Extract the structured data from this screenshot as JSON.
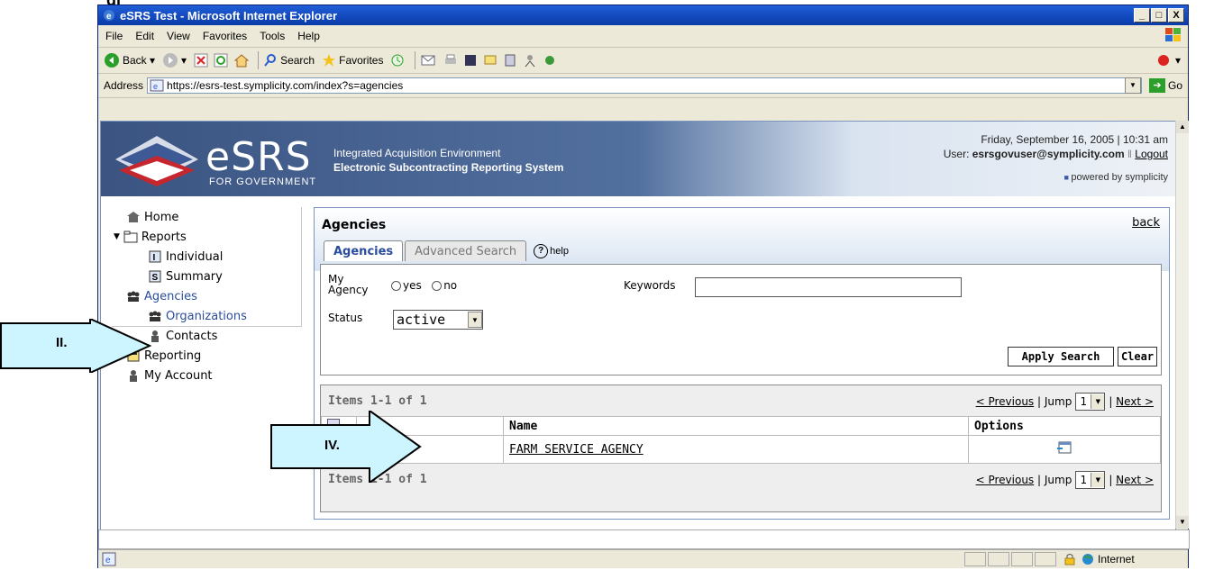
{
  "heading_fragment": "gl",
  "window": {
    "title": "eSRS Test - Microsoft Internet Explorer",
    "controls": [
      "_",
      "□",
      "X"
    ]
  },
  "menu": [
    "File",
    "Edit",
    "View",
    "Favorites",
    "Tools",
    "Help"
  ],
  "toolbar": {
    "back": "Back",
    "search": "Search",
    "favorites": "Favorites"
  },
  "address": {
    "label": "Address",
    "url": "https://esrs-test.symplicity.com/index?s=agencies",
    "go": "Go"
  },
  "banner": {
    "logo_text": "eSRS",
    "for_government": "FOR GOVERNMENT",
    "subtitle1": "Integrated Acquisition Environment",
    "subtitle2": "Electronic Subcontracting Reporting System",
    "date": "Friday, September 16, 2005 | 10:31 am",
    "user_label": "User:",
    "user_email": "esrsgovuser@symplicity.com",
    "logout": "Logout",
    "powered": "powered by symplicity"
  },
  "sidebar": {
    "home": "Home",
    "reports": "Reports",
    "individual": "Individual",
    "summary": "Summary",
    "agencies": "Agencies",
    "organizations": "Organizations",
    "contacts": "Contacts",
    "reporting": "Reporting",
    "my_account": "My Account"
  },
  "main": {
    "title": "Agencies",
    "back": "back",
    "tabs": [
      "Agencies",
      "Advanced Search"
    ],
    "help": "help",
    "search": {
      "my_agency_label_1": "My",
      "my_agency_label_2": "Agency",
      "yes": "yes",
      "no": "no",
      "keywords_label": "Keywords",
      "keywords_value": "",
      "status_label": "Status",
      "status_value": "active",
      "apply": "Apply Search",
      "clear": "Clear"
    },
    "results": {
      "count": "Items 1-1 of 1",
      "previous": "< Previous",
      "jump": "Jump",
      "jump_value": "1",
      "next": "Next >",
      "columns": [
        "",
        "Name",
        "Options"
      ],
      "rows": [
        {
          "name": "FARM SERVICE AGENCY"
        }
      ]
    }
  },
  "callouts": {
    "ii": "II.",
    "iv": "IV."
  },
  "status": {
    "zone": "Internet"
  }
}
